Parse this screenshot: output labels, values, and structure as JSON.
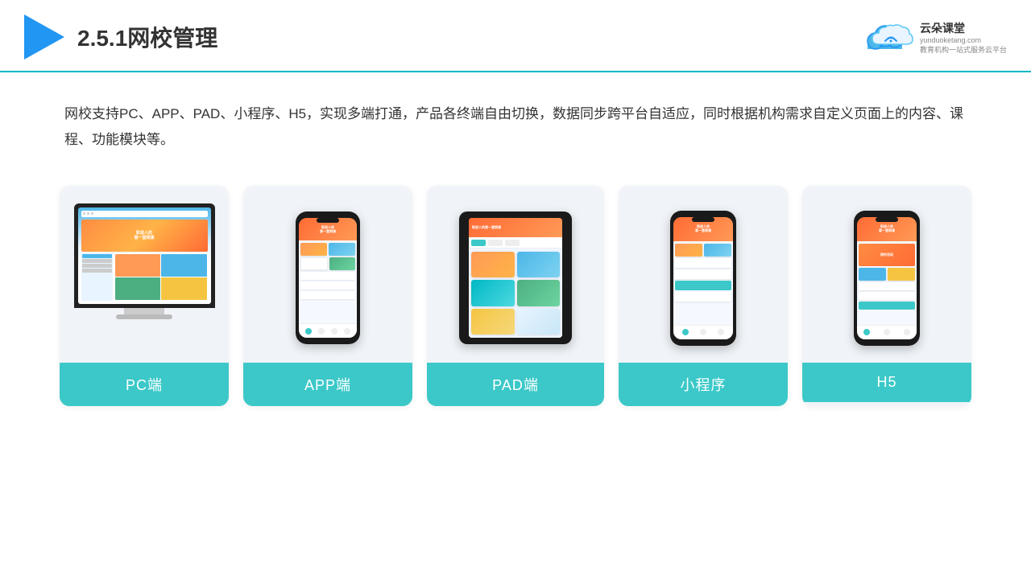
{
  "header": {
    "section_number": "2.5.1",
    "title": "网校管理",
    "brand_name": "云朵课堂",
    "brand_url": "yunduoketang.com",
    "brand_tagline1": "教育机构一站",
    "brand_tagline2": "式服务云平台"
  },
  "description": {
    "text": "网校支持PC、APP、PAD、小程序、H5，实现多端打通，产品各终端自由切换，数据同步跨平台自适应，同时根据机构需求自定义页面上的内容、课程、功能模块等。"
  },
  "cards": [
    {
      "id": "pc",
      "label": "PC端"
    },
    {
      "id": "app",
      "label": "APP端"
    },
    {
      "id": "pad",
      "label": "PAD端"
    },
    {
      "id": "miniapp",
      "label": "小程序"
    },
    {
      "id": "h5",
      "label": "H5"
    }
  ],
  "colors": {
    "teal": "#3cc8c8",
    "blue": "#2196f3",
    "border_bottom": "#00b8c4"
  }
}
